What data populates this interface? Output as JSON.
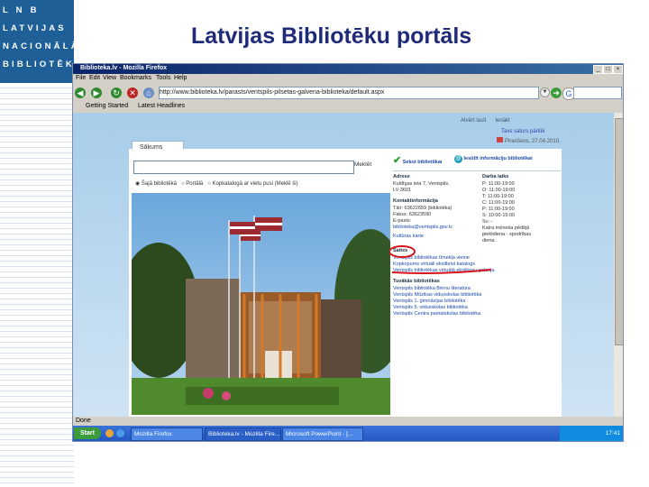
{
  "slide": {
    "title": "Latvijas Bibliotēku portāls",
    "logo_lines": [
      "L N B",
      "LATVIJAS",
      "NACIONĀLĀ",
      "BIBLIOTĒKA"
    ]
  },
  "browser": {
    "window_title": "Biblioteka.lv - Mozilla Firefox",
    "menu": [
      "File",
      "Edit",
      "View",
      "Bookmarks",
      "Tools",
      "Help"
    ],
    "url": "http://www.biblioteka.lv/parasts/ventspils-pilsetas-galvena-biblioteka/default.aspx",
    "bookmarks": [
      "Getting Started",
      "Latest Headlines"
    ],
    "status": "Done",
    "taskbar": {
      "start": "Start",
      "tasks": [
        "Mozilla Firefox",
        "Biblioteka.lv - Mozilla Fire...",
        "Microsoft PowerPoint - [..."
      ],
      "clock": "17:41"
    }
  },
  "site": {
    "top_links": [
      "Atvērt lasīt",
      "Ienākt"
    ],
    "side_links": [
      "Tavs saturs pārlūk",
      "Piranšens, 27.04.2010."
    ],
    "tab_home": "Sākums",
    "search_button": "Meklēt",
    "radios": [
      "Šajā bibliotēkā",
      "Portālā",
      "Kopkatalogā ar vietu pusi (Meklē ši)"
    ],
    "panel": {
      "tab_active": "Sekot bibliotēkai",
      "tab_other": "Iesūtīt informāciju bibliotēkai",
      "address_h": "Adrese",
      "address": [
        "Kuldīgas iela 7, Ventspils,",
        "LV-3601"
      ],
      "hours_h": "Darba laiks",
      "hours": [
        "P: 11:00-19:00",
        "O: 11:00-19:00",
        "T: 11:00-19:00",
        "C: 11:00-19:00",
        "P: 11:00-19:00",
        "S: 10:00-15:00",
        "Sv: -"
      ],
      "hours_note": [
        "Katra mēneša pēdējā",
        "piektdiena - spodrības",
        "diena."
      ],
      "contact_h": "Kontaktinformācija",
      "contact": [
        "Tālr: 63622659 (bibliotēka)",
        "Fakss: 63623590",
        "E-pasts:",
        "biblioteka@ventspils.gov.lv"
      ],
      "map_link": "Kultūras karte",
      "links_h": "Saites",
      "links": [
        "Ventspils bibliotēkas tīmekļa vietne",
        "Kopkopums virtuāli ekslibrisi katalogs",
        "Ventspils bibliotēkas virtuālā ekslibrisu galerija"
      ],
      "nearby_h": "Tuvākās bibliotēkas",
      "nearby": [
        "Ventspils bibliotēka Bērnu literatūra",
        "Ventspils Mūzikas vidusskolas bibliotēka",
        "Ventspils 1. ģimnāzijas bibliotēka",
        "Ventspils 5. vidusskolas bibliotēka",
        "Ventspils Centra pamatskolas bibliotēka"
      ]
    }
  },
  "colors": {
    "logo_bg": "#1d5f96",
    "title_text": "#1f2a78",
    "annotation_red": "#d8141c"
  }
}
